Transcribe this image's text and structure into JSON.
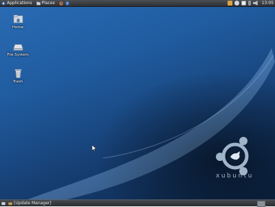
{
  "top_panel": {
    "applications_label": "Applications",
    "places_label": "Places",
    "clock": "13:05"
  },
  "desktop": {
    "icons": [
      {
        "label": "Home",
        "icon": "home-folder-icon"
      },
      {
        "label": "File System",
        "icon": "drive-icon"
      },
      {
        "label": "Trash",
        "icon": "trash-icon"
      }
    ],
    "brand_text": "xubuntu"
  },
  "bottom_panel": {
    "task_label": "[Update Manager]"
  },
  "colors": {
    "panel": "#2c2f33",
    "desktop_blue": "#1f5a9d"
  }
}
